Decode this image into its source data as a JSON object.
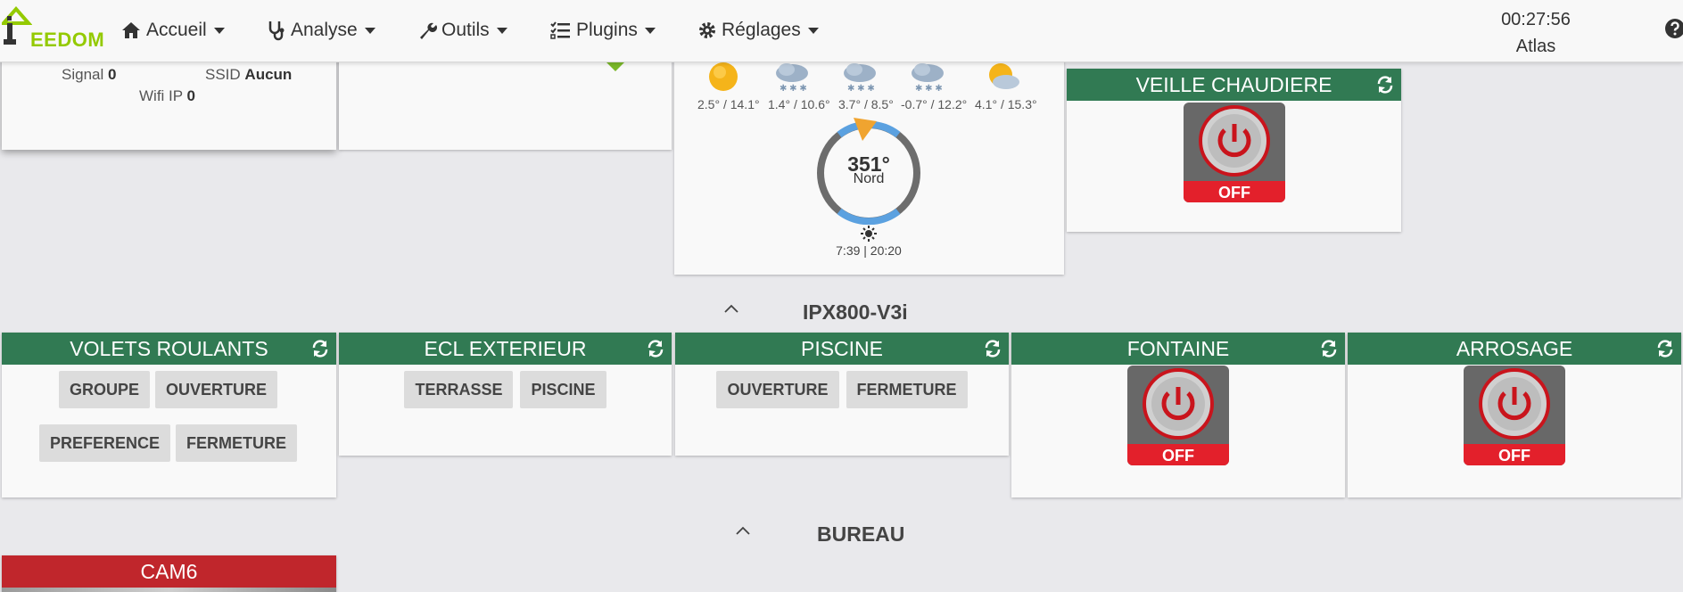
{
  "app": {
    "logo_text": "EEDOM"
  },
  "nav": {
    "items": [
      {
        "label": "Accueil",
        "icon": "home-icon"
      },
      {
        "label": "Analyse",
        "icon": "stethoscope-icon"
      },
      {
        "label": "Outils",
        "icon": "wrench-icon"
      },
      {
        "label": "Plugins",
        "icon": "tasks-icon"
      },
      {
        "label": "Réglages",
        "icon": "gear-icon"
      }
    ],
    "time": "00:27:56",
    "user": "Atlas"
  },
  "network_widget": {
    "signal_label": "Signal",
    "signal_value": "0",
    "ssid_label": "SSID",
    "ssid_value": "Aucun",
    "wifi_label": "Wifi IP",
    "wifi_value": "0"
  },
  "weather": {
    "forecast": [
      {
        "range": "2.5° / 14.1°",
        "icon": "sun-icon"
      },
      {
        "range": "1.4° / 10.6°",
        "icon": "snow-cloud-icon"
      },
      {
        "range": "3.7° / 8.5°",
        "icon": "snow-cloud-icon"
      },
      {
        "range": "-0.7° / 12.2°",
        "icon": "snow-cloud-icon"
      },
      {
        "range": "4.1° / 15.3°",
        "icon": "sun-cloud-icon"
      }
    ],
    "wind_degrees": "351°",
    "wind_direction": "Nord",
    "sun_times": "7:39 | 20:20"
  },
  "veille": {
    "title": "VEILLE CHAUDIERE",
    "state": "OFF"
  },
  "sections": {
    "ipx": "IPX800-V3i",
    "bureau": "BUREAU"
  },
  "volets": {
    "title": "VOLETS ROULANTS",
    "buttons": [
      "GROUPE",
      "OUVERTURE",
      "PREFERENCE",
      "FERMETURE"
    ]
  },
  "ecl": {
    "title": "ECL EXTERIEUR",
    "buttons": [
      "TERRASSE",
      "PISCINE"
    ]
  },
  "piscine": {
    "title": "PISCINE",
    "buttons": [
      "OUVERTURE",
      "FERMETURE"
    ]
  },
  "fontaine": {
    "title": "FONTAINE",
    "state": "OFF"
  },
  "arrosage": {
    "title": "ARROSAGE",
    "state": "OFF"
  },
  "cam": {
    "title": "CAM6"
  },
  "colors": {
    "header_green": "#317a53",
    "header_red": "#c0262c",
    "logo_green": "#94ca02"
  }
}
